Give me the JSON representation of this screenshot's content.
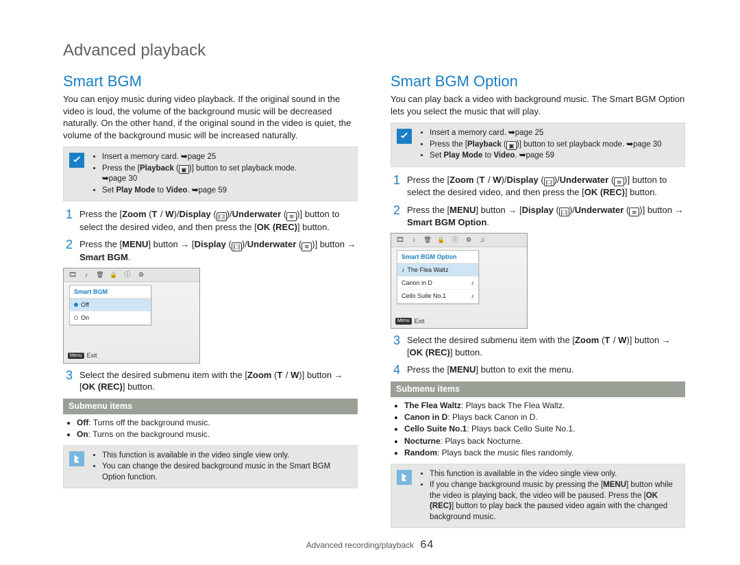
{
  "page": {
    "title": "Advanced playback",
    "footer_label": "Advanced recording/playback",
    "page_number": "64"
  },
  "left": {
    "heading": "Smart BGM",
    "intro": "You can enjoy music during video playback. If the original sound in the video is loud, the volume of the background music will be decreased naturally. On the other hand, if the original sound in the video is quiet, the volume of the background music will be increased naturally.",
    "prereq": {
      "items": [
        {
          "pre": "Insert a memory card. ",
          "ref": "page 25"
        },
        {
          "pre": "Press the [",
          "b": "Playback",
          "post": " (",
          "post2": ")] button to set playback mode. ",
          "ref": "page 30"
        },
        {
          "pre": "Set ",
          "b": "Play Mode",
          "mid": " to ",
          "b2": "Video",
          "post": ". ",
          "ref": "page 59"
        }
      ]
    },
    "steps": [
      {
        "num": "1",
        "segments": [
          "Press the [",
          "Zoom",
          " (",
          "T",
          " / ",
          "W",
          ")/",
          "Display",
          " (",
          "",
          ")/",
          "Underwater",
          " (",
          "",
          ")] button to select the desired video, and then press the [",
          "OK (REC)",
          "] button."
        ]
      },
      {
        "num": "2",
        "segments": [
          "Press the [",
          "MENU",
          "] button → [",
          "Display",
          " (",
          "",
          ")/",
          "Underwater",
          " (",
          "",
          ")] button → ",
          "Smart BGM",
          "."
        ]
      },
      {
        "num": "3",
        "segments": [
          "Select the desired submenu item with the [",
          "Zoom",
          " (",
          "T",
          " / ",
          "W",
          ")] button → [",
          "OK (REC)",
          "] button."
        ]
      }
    ],
    "lcd": {
      "title": "Smart BGM",
      "items": [
        "Off",
        "On"
      ],
      "selected": 0,
      "exit_label": "Exit",
      "menu_badge": "Menu"
    },
    "submenu": {
      "title": "Submenu items",
      "items": [
        {
          "label": "Off",
          "desc": ": Turns off the background music."
        },
        {
          "label": "On",
          "desc": ": Turns on the background music."
        }
      ]
    },
    "notes": [
      "This function is available in the video single view only.",
      "You can change the desired background music in the Smart BGM Option function."
    ]
  },
  "right": {
    "heading": "Smart BGM Option",
    "intro": "You can play back a video with background music. The Smart BGM Option lets you select the music that will play.",
    "prereq": {
      "items": [
        {
          "pre": "Insert a memory card. ",
          "ref": "page 25"
        },
        {
          "pre": "Press the [",
          "b": "Playback",
          "post": " (",
          "post2": ")] button to set playback mode. ",
          "ref": "page 30"
        },
        {
          "pre": "Set ",
          "b": "Play Mode",
          "mid": " to ",
          "b2": "Video",
          "post": ". ",
          "ref": "page 59"
        }
      ]
    },
    "steps": [
      {
        "num": "1",
        "segments": [
          "Press the [",
          "Zoom",
          " (",
          "T",
          " / ",
          "W",
          ")/",
          "Display",
          " (",
          "",
          ")/",
          "Underwater",
          " (",
          "",
          ")] button to select the desired video, and then press the [",
          "OK (REC)",
          "] button."
        ]
      },
      {
        "num": "2",
        "segments": [
          "Press the [",
          "MENU",
          "] button → [",
          "Display",
          " (",
          "",
          ")/",
          "Underwater",
          " (",
          "",
          ")] button → ",
          "Smart BGM Option",
          "."
        ]
      },
      {
        "num": "3",
        "segments": [
          "Select the desired submenu item with the [",
          "Zoom",
          " (",
          "T",
          " / ",
          "W",
          ")] button → [",
          "OK (REC)",
          "] button."
        ]
      },
      {
        "num": "4",
        "segments": [
          "Press the [",
          "MENU",
          "] button to exit the menu."
        ]
      }
    ],
    "lcd": {
      "title": "Smart BGM Option",
      "items": [
        "The Flea Waltz",
        "Canon in D",
        "Cello Suite No.1"
      ],
      "selected": 0,
      "exit_label": "Exit",
      "menu_badge": "Menu"
    },
    "submenu": {
      "title": "Submenu items",
      "items": [
        {
          "label": "The Flea Waltz",
          "desc": ": Plays back The Flea Waltz."
        },
        {
          "label": "Canon in D",
          "desc": ": Plays back Canon in D."
        },
        {
          "label": "Cello Suite No.1",
          "desc": ": Plays back Cello Suite No.1."
        },
        {
          "label": "Nocturne",
          "desc": ": Plays back Nocturne."
        },
        {
          "label": "Random",
          "desc": ": Plays back the music files randomly."
        }
      ]
    },
    "notes": [
      "This function is available in the video single view only.",
      "If you change background music by pressing the [MENU] button while the video is playing back, the video will be paused. Press the [OK (REC)] button to play back the paused video again with the changed background music."
    ]
  }
}
